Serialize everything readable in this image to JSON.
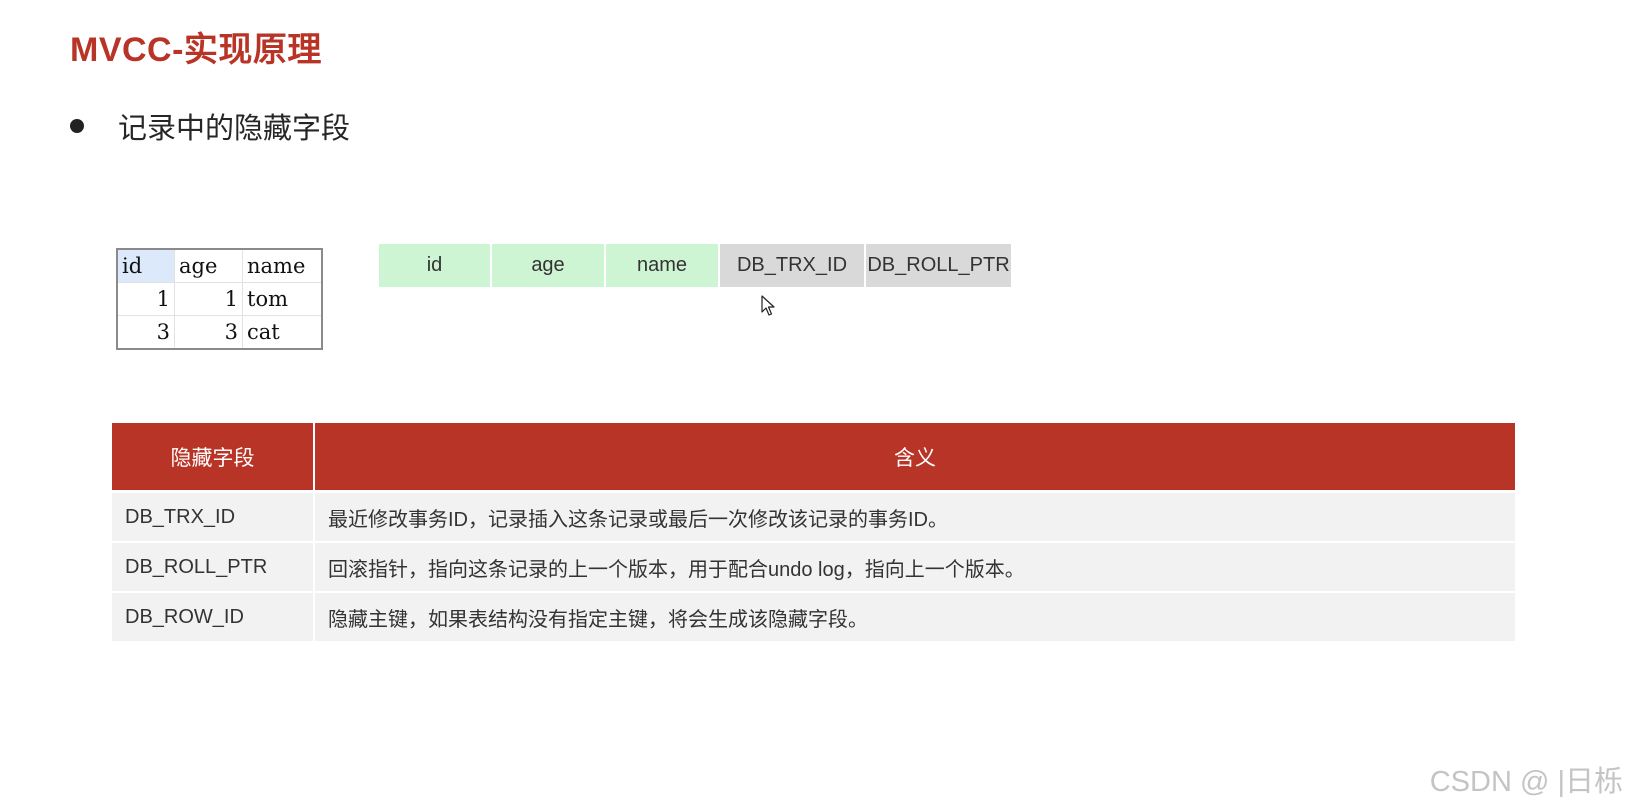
{
  "slide": {
    "title": "MVCC-实现原理",
    "bullet": "记录中的隐藏字段"
  },
  "mini_table": {
    "headers": [
      "id",
      "age",
      "name"
    ],
    "rows": [
      [
        "1",
        "1",
        "tom"
      ],
      [
        "3",
        "3",
        "cat"
      ]
    ]
  },
  "field_strip": {
    "visible_fields": [
      "id",
      "age",
      "name"
    ],
    "hidden_fields": [
      "DB_TRX_ID",
      "DB_ROLL_PTR"
    ],
    "colors": {
      "visible": "#cdf5d3",
      "hidden": "#d9d9d9"
    }
  },
  "hidden_fields_table": {
    "headers": [
      "隐藏字段",
      "含义"
    ],
    "rows": [
      {
        "field": "DB_TRX_ID",
        "meaning": "最近修改事务ID，记录插入这条记录或最后一次修改该记录的事务ID。"
      },
      {
        "field": "DB_ROLL_PTR",
        "meaning": "回滚指针，指向这条记录的上一个版本，用于配合undo log，指向上一个版本。"
      },
      {
        "field": "DB_ROW_ID",
        "meaning": "隐藏主键，如果表结构没有指定主键，将会生成该隐藏字段。"
      }
    ],
    "colors": {
      "header": "#b83426",
      "row": "#f2f2f2"
    }
  },
  "cursor_icon": "mouse-pointer-icon",
  "watermark": "CSDN @ |日栎"
}
